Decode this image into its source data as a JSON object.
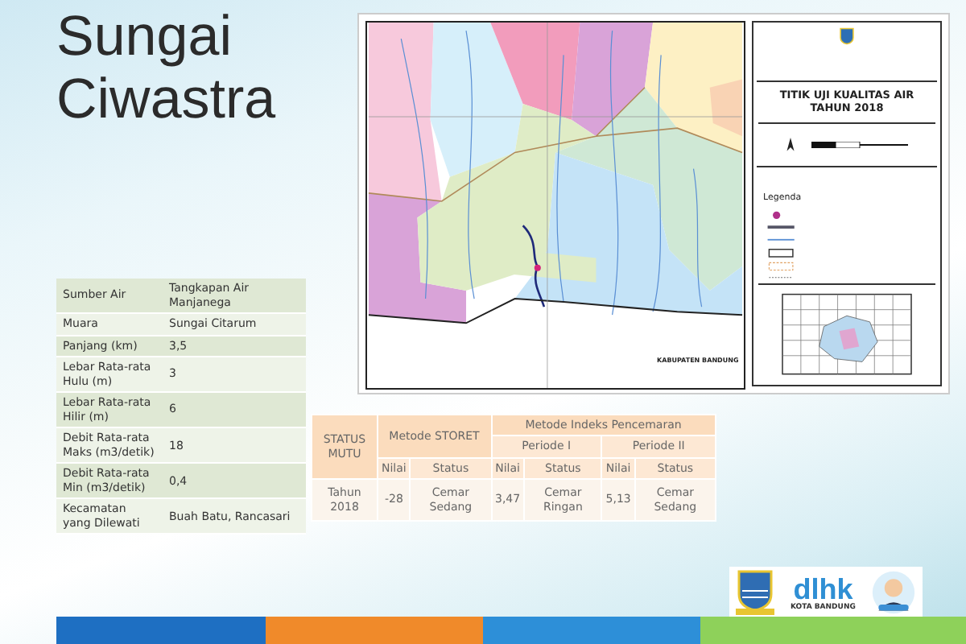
{
  "title": "Sungai Ciwastra",
  "map": {
    "region_label": "KABUPATEN BANDUNG",
    "map_title": "TITIK UJI KUALITAS AIR TAHUN 2018",
    "legend_heading": "Legenda"
  },
  "info_table": [
    {
      "label": "Sumber Air",
      "value": "Tangkapan Air Manjanega"
    },
    {
      "label": "Muara",
      "value": "Sungai Citarum"
    },
    {
      "label": "Panjang (km)",
      "value": "3,5"
    },
    {
      "label": "Lebar Rata-rata Hulu (m)",
      "value": "3"
    },
    {
      "label": "Lebar Rata-rata Hilir (m)",
      "value": "6"
    },
    {
      "label": "Debit Rata-rata Maks (m3/detik)",
      "value": "18"
    },
    {
      "label": "Debit Rata-rata Min (m3/detik)",
      "value": "0,4"
    },
    {
      "label": "Kecamatan yang Dilewati",
      "value": "Buah Batu, Rancasari"
    }
  ],
  "status_table": {
    "corner": "STATUS MUTU",
    "method_storet": "Metode STORET",
    "method_index": "Metode Indeks Pencemaran",
    "periods": [
      "Periode I",
      "Periode II"
    ],
    "subheaders": [
      "Nilai",
      "Status",
      "Nilai",
      "Status",
      "Nilai",
      "Status"
    ],
    "rows": [
      {
        "label": "Tahun 2018",
        "cells": [
          "-28",
          "Cemar Sedang",
          "3,47",
          "Cemar Ringan",
          "5,13",
          "Cemar Sedang"
        ]
      }
    ]
  },
  "logos": {
    "agency": "dlhk",
    "city": "KOTA BANDUNG"
  }
}
